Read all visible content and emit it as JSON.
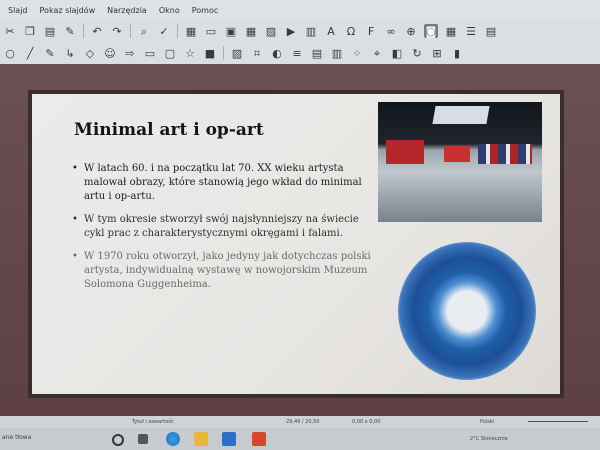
{
  "menu": {
    "items": [
      "Slajd",
      "Pokaz slajdów",
      "Narzędzia",
      "Okno",
      "Pomoc"
    ]
  },
  "toolbar1": {
    "icons": [
      "cut-icon",
      "copy-icon",
      "paste-icon",
      "brush-icon",
      "undo-icon",
      "redo-icon",
      "find-icon",
      "spellcheck-icon",
      "grid-icon",
      "display-icon",
      "slide-icon",
      "table-icon",
      "image-icon",
      "media-icon",
      "chart-icon",
      "textbox-icon",
      "special-char-icon",
      "fontwork-icon",
      "hyperlink-icon",
      "globe-icon",
      "camera-icon",
      "table2-icon",
      "rows-icon",
      "grid2-icon"
    ]
  },
  "toolbar2": {
    "icons": [
      "select-icon",
      "line-icon",
      "rect-icon",
      "ellipse-icon",
      "pen-icon",
      "connector-icon",
      "diamond-icon",
      "smiley-icon",
      "arrow-icon",
      "flowchart-icon",
      "callout-icon",
      "star-icon",
      "3d-icon",
      "shadow-icon",
      "crop-icon",
      "filter-icon",
      "align-icon",
      "arrange-icon",
      "distribute-icon",
      "points-icon",
      "glue-icon",
      "toggle-icon",
      "rotate-icon",
      "extrusion-icon",
      "fill-icon"
    ]
  },
  "slide": {
    "title": "Minimal art i op-art",
    "bullets": [
      "W latach 60. i na początku lat 70. XX wieku artysta malował obrazy, które stanowią jego wkład do minimal artu i op-artu.",
      "W tym okresie stworzył swój najsłynniejszy na świecie cykl prac z charakterystycznymi okręgami i falami.",
      "W 1970 roku otworzył, jako jedyny jak dotychczas polski artysta, indywidualną wystawę w nowojorskim Muzeum Solomona Guggenheima."
    ]
  },
  "statusbar": {
    "layout": "Tytuł i zawartość",
    "coords": "29,49 / 20,50",
    "size": "0,00 x 0,00",
    "language": "Polski"
  },
  "taskbar": {
    "search": "ane tłowa",
    "weather": "2°C  Słonecznie"
  }
}
